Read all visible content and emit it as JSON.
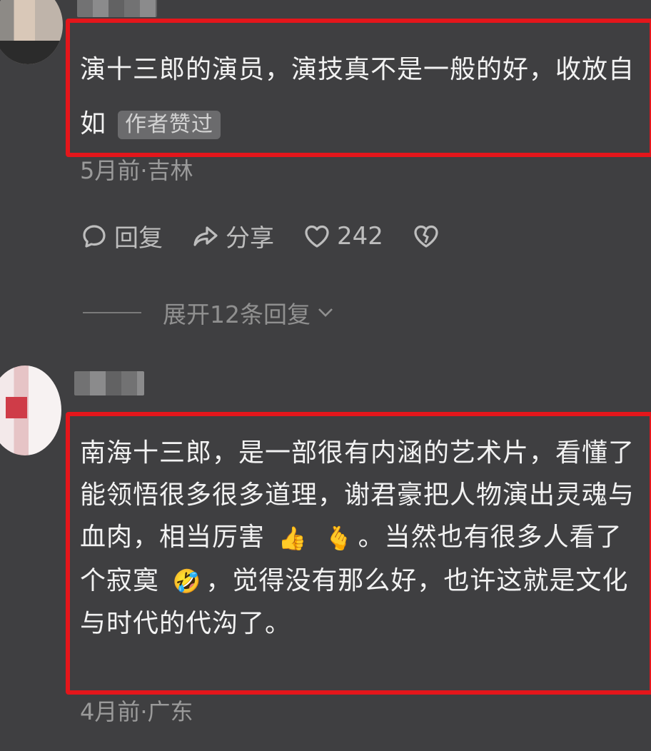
{
  "comments": [
    {
      "text": "演十三郎的演员，演技真不是一般的好，收放自如",
      "badge": "作者赞过",
      "meta": "5月前·吉林",
      "actions": {
        "reply": "回复",
        "share": "分享",
        "likes": "242"
      },
      "expand": "展开12条回复"
    },
    {
      "text_part1": "南海十三郎，是一部很有内涵的艺术片，看懂了能领悟很多很多道理，谢君豪把人物演出灵魂与血肉，相当厉害",
      "emoji1": "👍",
      "emoji2": "🫰",
      "text_part2": "。当然也有很多人看了个寂寞",
      "emoji3": "🤣",
      "text_part3": "，觉得没有那么好，也许这就是文化与时代的代沟了。",
      "meta": "4月前·广东"
    }
  ],
  "icons": [
    "reply-icon",
    "share-icon",
    "heart-icon",
    "broken-heart-icon",
    "chevron-down-icon"
  ],
  "colors": {
    "background": "#3f3f41",
    "highlight": "#e4161b"
  }
}
